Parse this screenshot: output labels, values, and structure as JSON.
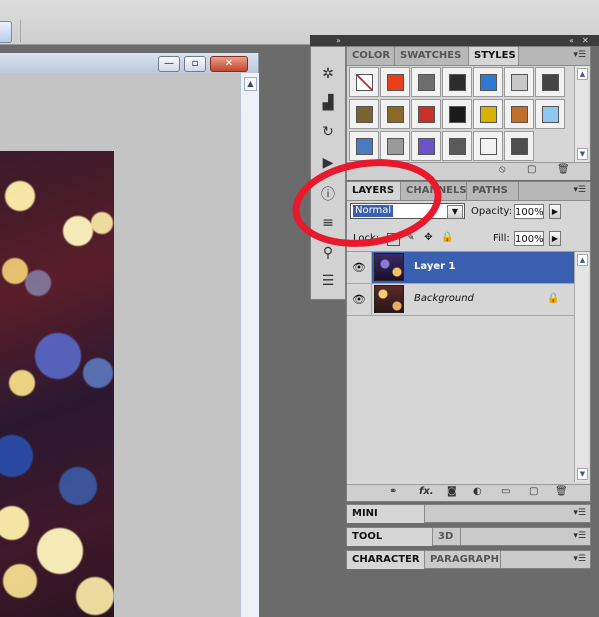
{
  "document": {
    "minimize": "—",
    "restore": "▫",
    "close": "✕"
  },
  "color_panel": {
    "tabs": [
      "COLOR",
      "SWATCHES",
      "STYLES"
    ],
    "active_tab": "STYLES",
    "styles": [
      {
        "name": "none-style",
        "color": "#ffffff"
      },
      {
        "name": "red-orange-style",
        "color": "#e8401a"
      },
      {
        "name": "gray-style",
        "color": "#6e6e6e"
      },
      {
        "name": "dark-sphere-style",
        "color": "#2c2c2c"
      },
      {
        "name": "blue-style",
        "color": "#2e7ad0"
      },
      {
        "name": "light-gray-style",
        "color": "#c8c8c8"
      },
      {
        "name": "dark-gradient-style",
        "color": "#444444"
      },
      {
        "name": "olive-style",
        "color": "#7a6330"
      },
      {
        "name": "bronze-style",
        "color": "#8a6a2a"
      },
      {
        "name": "red-stripe-style",
        "color": "#c83028"
      },
      {
        "name": "multicolor-style",
        "color": "#1a1a1a"
      },
      {
        "name": "gold-style",
        "color": "#d8b000"
      },
      {
        "name": "copper-style",
        "color": "#c0702a"
      },
      {
        "name": "light-blue-style",
        "color": "#8ec8f0"
      },
      {
        "name": "sky-style",
        "color": "#4a7ac0"
      },
      {
        "name": "silver-pattern-style",
        "color": "#9a9a9a"
      },
      {
        "name": "purple-style",
        "color": "#6a52c8"
      },
      {
        "name": "dark-gray-style",
        "color": "#5a5a5a"
      },
      {
        "name": "white-style",
        "color": "#f2f2f2"
      },
      {
        "name": "charcoal-style",
        "color": "#4e4e4e"
      }
    ]
  },
  "layers_panel": {
    "tabs": [
      "LAYERS",
      "CHANNELS",
      "PATHS"
    ],
    "active_tab": "LAYERS",
    "blend_mode": "Normal",
    "opacity_label": "Opacity:",
    "opacity_value": "100%",
    "lock_label": "Lock:",
    "fill_label": "Fill:",
    "fill_value": "100%",
    "layers": [
      {
        "name": "Layer 1",
        "selected": true
      },
      {
        "name": "Background",
        "selected": false,
        "locked": true
      }
    ],
    "bottom_icons": [
      "link-layers-icon",
      "fx-icon",
      "mask-icon",
      "adjustment-icon",
      "group-icon",
      "new-layer-icon",
      "trash-icon"
    ],
    "fx_label": "fx."
  },
  "collapsed_panels": {
    "mini_bridge": "MINI BRIDGE",
    "tool_presets": "TOOL PRESETS",
    "three_d": "3D",
    "character": "CHARACTER",
    "paragraph": "PARAGRAPH"
  },
  "accent_color": "#3a5fb0",
  "annotation_color": "#e8192c"
}
